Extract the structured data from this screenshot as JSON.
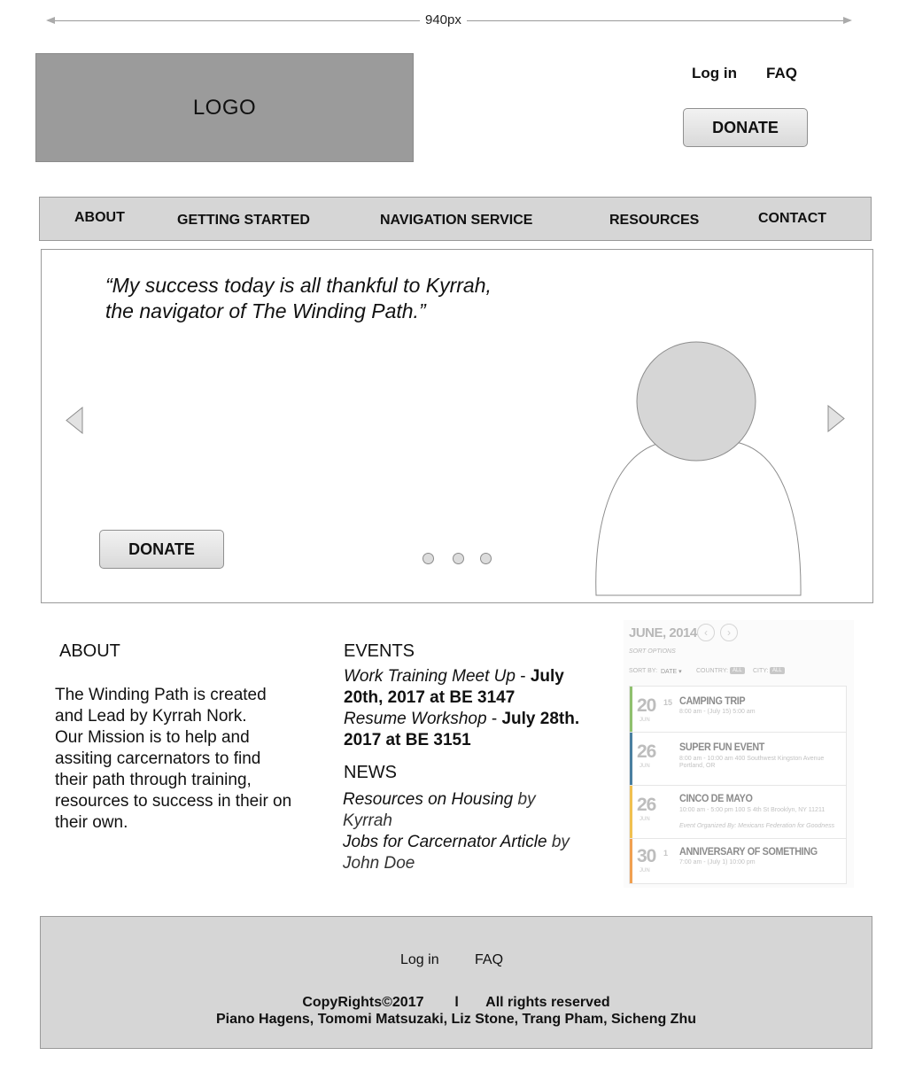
{
  "ruler": {
    "label": "940px"
  },
  "header": {
    "logo": "LOGO",
    "login": "Log in",
    "faq": "FAQ",
    "donate": "DONATE"
  },
  "nav": [
    "ABOUT",
    "GETTING STARTED",
    "NAVIGATION SERVICE",
    "RESOURCES",
    "CONTACT"
  ],
  "carousel": {
    "quote_line1": "“My success today is all thankful to Kyrrah,",
    "quote_line2": "the navigator of The Winding Path.”",
    "donate": "DONATE",
    "slide_count": 3
  },
  "about": {
    "title": "ABOUT",
    "p1": "The Winding Path is created and Lead by Kyrrah Nork.",
    "p2": "Our Mission is to help and assiting carcernators to find their path through training, resources to success in their on their own."
  },
  "events": {
    "title": "EVENTS",
    "items": [
      {
        "name": "Work Training Meet Up",
        "sep": " - ",
        "when": "July 20th, 2017 at BE 3147"
      },
      {
        "name": "Resume Workshop",
        "sep": " - ",
        "when": "July 28th. 2017 at BE 3151"
      }
    ]
  },
  "news": {
    "title": "NEWS",
    "items": [
      {
        "title": "Resources on Housing",
        "byline": " by Kyrrah"
      },
      {
        "title": "Jobs for Carcernator Article",
        "byline": " by John Doe"
      }
    ]
  },
  "calendar": {
    "month": "JUNE, 2014",
    "sort_options": "SORT OPTIONS",
    "sort_by": "SORT BY:",
    "sort_value": "DATE",
    "country": "COUNTRY:",
    "city": "CITY:",
    "all": "ALL",
    "events": [
      {
        "day": "20",
        "end_day": "15",
        "month": "JUN",
        "title": "CAMPING TRIP",
        "meta": "8:00 am - (July 15) 5:00 am",
        "color": "#8fc06e"
      },
      {
        "day": "26",
        "month": "JUN",
        "title": "SUPER FUN EVENT",
        "meta": "8:00 am - 10:00 am  400 Southwest Kingston Avenue Portland, OR",
        "color": "#4a7fa0"
      },
      {
        "day": "26",
        "month": "JUN",
        "title": "CINCO DE MAYO",
        "meta": "10:00 am - 5:00 pm  100 S 4th St Brooklyn, NY 11211",
        "organizer": "Event Organized By: Mexicans Federation for Goodness",
        "color": "#f0c050"
      },
      {
        "day": "30",
        "end_day": "1",
        "month": "JUN",
        "title": "ANNIVERSARY OF SOMETHING",
        "meta": "7:00 am - (July 1) 10:00 pm",
        "color": "#f0a050"
      }
    ]
  },
  "footer": {
    "login": "Log in",
    "faq": "FAQ",
    "copyright": "CopyRights©2017",
    "divider": "l",
    "rights": "All rights reserved",
    "authors": "Piano Hagens, Tomomi Matsuzaki, Liz Stone, Trang Pham, Sicheng Zhu"
  },
  "colors": {
    "logo_bg": "#9b9b9b",
    "bar_bg": "#d6d6d6",
    "border": "#9a9a9a"
  }
}
